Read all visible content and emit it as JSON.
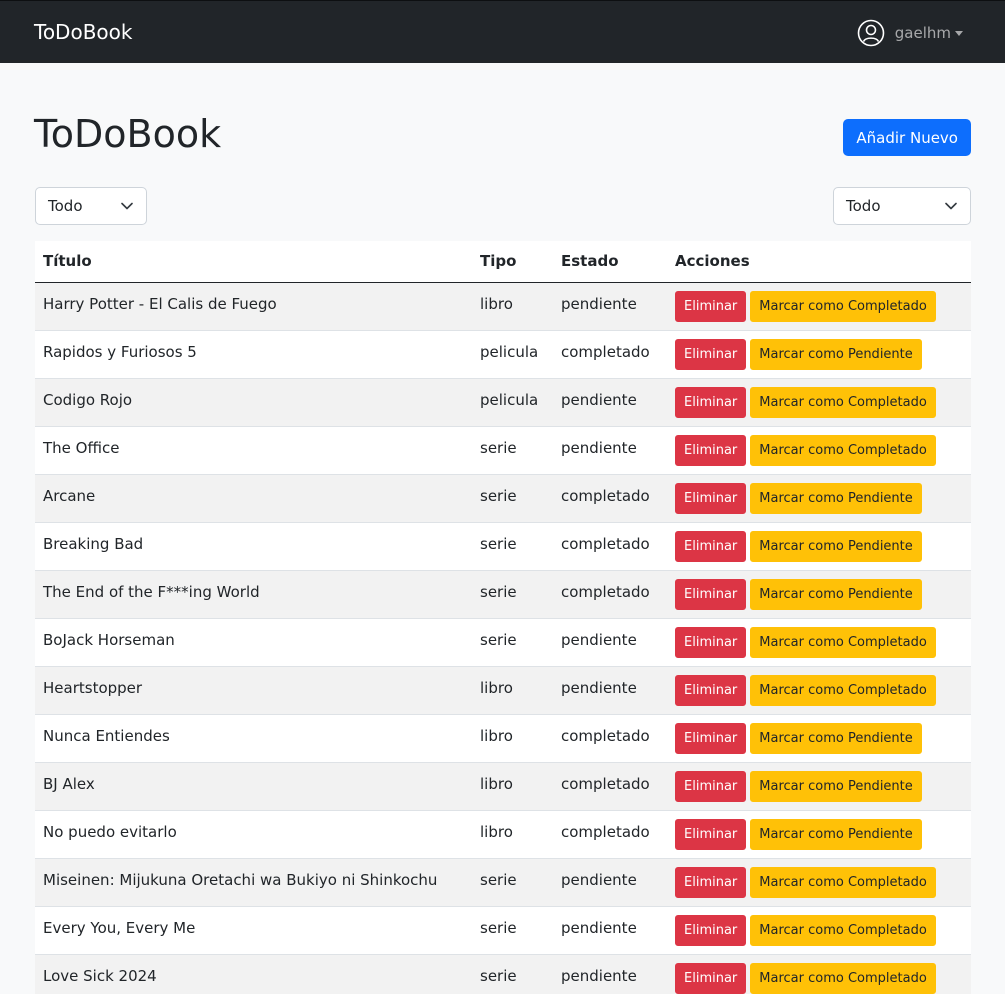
{
  "navbar": {
    "brand": "ToDoBook",
    "user": "gaelhm"
  },
  "header": {
    "title": "ToDoBook",
    "add_button": "Añadir Nuevo"
  },
  "filters": {
    "left_selected": "Todo",
    "right_selected": "Todo"
  },
  "table": {
    "columns": [
      "Título",
      "Tipo",
      "Estado",
      "Acciones"
    ],
    "delete_label": "Eliminar",
    "rows": [
      {
        "titulo": "Harry Potter - El Calis de Fuego",
        "tipo": "libro",
        "estado": "pendiente",
        "mark": "Marcar como Completado"
      },
      {
        "titulo": "Rapidos y Furiosos 5",
        "tipo": "pelicula",
        "estado": "completado",
        "mark": "Marcar como Pendiente"
      },
      {
        "titulo": "Codigo Rojo",
        "tipo": "pelicula",
        "estado": "pendiente",
        "mark": "Marcar como Completado"
      },
      {
        "titulo": "The Office",
        "tipo": "serie",
        "estado": "pendiente",
        "mark": "Marcar como Completado"
      },
      {
        "titulo": "Arcane",
        "tipo": "serie",
        "estado": "completado",
        "mark": "Marcar como Pendiente"
      },
      {
        "titulo": "Breaking Bad",
        "tipo": "serie",
        "estado": "completado",
        "mark": "Marcar como Pendiente"
      },
      {
        "titulo": "The End of the F***ing World",
        "tipo": "serie",
        "estado": "completado",
        "mark": "Marcar como Pendiente"
      },
      {
        "titulo": "BoJack Horseman",
        "tipo": "serie",
        "estado": "pendiente",
        "mark": "Marcar como Completado"
      },
      {
        "titulo": "Heartstopper",
        "tipo": "libro",
        "estado": "pendiente",
        "mark": "Marcar como Completado"
      },
      {
        "titulo": "Nunca Entiendes",
        "tipo": "libro",
        "estado": "completado",
        "mark": "Marcar como Pendiente"
      },
      {
        "titulo": "BJ Alex",
        "tipo": "libro",
        "estado": "completado",
        "mark": "Marcar como Pendiente"
      },
      {
        "titulo": "No puedo evitarlo",
        "tipo": "libro",
        "estado": "completado",
        "mark": "Marcar como Pendiente"
      },
      {
        "titulo": "Miseinen: Mijukuna Oretachi wa Bukiyo ni Shinkochu",
        "tipo": "serie",
        "estado": "pendiente",
        "mark": "Marcar como Completado"
      },
      {
        "titulo": "Every You, Every Me",
        "tipo": "serie",
        "estado": "pendiente",
        "mark": "Marcar como Completado"
      },
      {
        "titulo": "Love Sick 2024",
        "tipo": "serie",
        "estado": "pendiente",
        "mark": "Marcar como Completado"
      }
    ]
  },
  "colors": {
    "navbar": "#212529",
    "primary": "#0d6efd",
    "danger": "#dc3545",
    "warning": "#ffc107"
  },
  "icons": {
    "user": "user-circle-icon",
    "caret": "caret-down-icon",
    "select": "chevron-down-icon"
  }
}
